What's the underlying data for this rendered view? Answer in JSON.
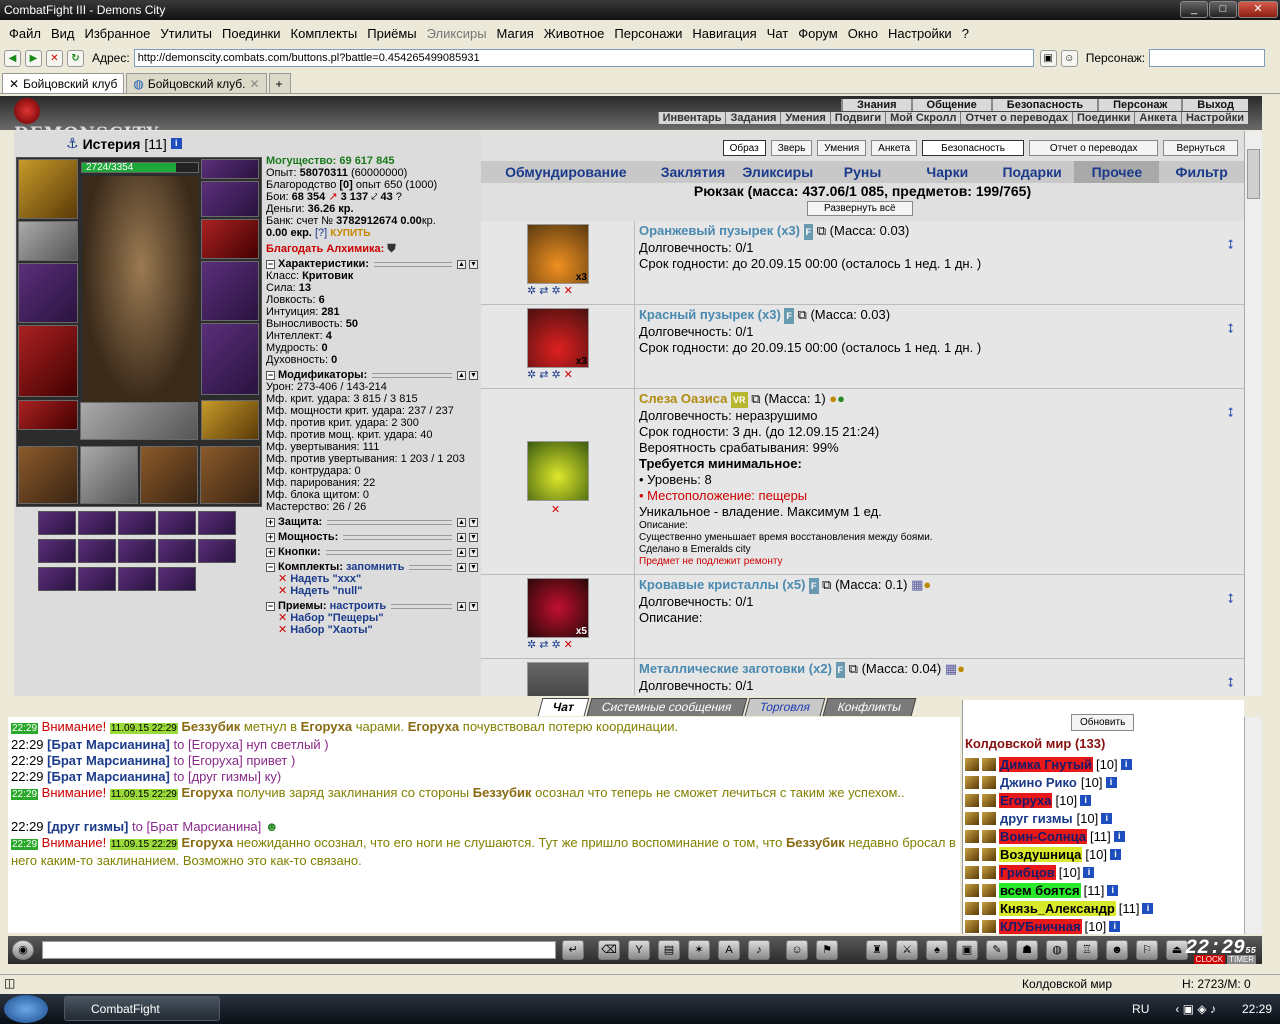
{
  "window": {
    "title": "CombatFight III - Demons City"
  },
  "menu": [
    "Файл",
    "Вид",
    "Избранное",
    "Утилиты",
    "Поединки",
    "Комплекты",
    "Приёмы",
    "Эликсиры",
    "Магия",
    "Животное",
    "Персонажи",
    "Навигация",
    "Чат",
    "Форум",
    "Окно",
    "Настройки",
    "?"
  ],
  "address": {
    "label": "Адрес:",
    "url": "http://demonscity.combats.com/buttons.pl?battle=0.454265499085931",
    "persona_label": "Персонаж:"
  },
  "tabs": [
    {
      "label": "Бойцовский клуб"
    },
    {
      "label": "Бойцовский клуб."
    }
  ],
  "game_nav": {
    "logo": "DEMONSCITY",
    "top": [
      "Знания",
      "Общение",
      "Безопасность",
      "Персонаж",
      "Выход"
    ],
    "bottom": [
      "Инвентарь",
      "Задания",
      "Умения",
      "Подвиги",
      "Мой Скролл",
      "Отчет о переводах",
      "Поединки",
      "Анкета",
      "Настройки"
    ]
  },
  "character": {
    "name": "Истерия",
    "level": "[11]",
    "hp": "2724/3354",
    "hp_fraction": 0.81
  },
  "stats": {
    "might": "Могущество: 69 617 845",
    "exp": "Опыт:",
    "exp_val": "58070311",
    "exp_next": "(60000000)",
    "nobility": "Благородство",
    "nobility_val": "[0]",
    "nobility_rest": "опыт 650 (1000)",
    "fights": "Бои:",
    "fights_val": "68 354",
    "fights_b": "3 137",
    "fights_c": "43",
    "money": "Деньги:",
    "money_val": "36.26 кр.",
    "bank": "Банк: счет №",
    "bank_val": "3782912674 0.00",
    "bank_unit": "кр.",
    "ekr": "0.00 екр.",
    "help": "[?]",
    "buy": "КУПИТЬ",
    "bless": "Благодать Алхимика:"
  },
  "sections": {
    "chars": "Характеристики:",
    "char_list": [
      [
        "Класс:",
        "Критовик"
      ],
      [
        "Сила:",
        "13"
      ],
      [
        "Ловкость:",
        "6"
      ],
      [
        "Интуиция:",
        "281"
      ],
      [
        "Выносливость:",
        "50"
      ],
      [
        "Интеллект:",
        "4"
      ],
      [
        "Мудрость:",
        "0"
      ],
      [
        "Духовность:",
        "0"
      ]
    ],
    "mods": "Модификаторы:",
    "mod_list": [
      "Урон: 273-406 / 143-214",
      "Мф. крит. удара: 3 815 / 3 815",
      "Мф. мощности крит. удара: 237 / 237",
      "Мф. против крит. удара: 2 300",
      "Мф. против мощ. крит. удара: 40",
      "Мф. увертывания: 111",
      "Мф. против увертывания: 1 203 / 1 203",
      "Мф. контрудара: 0",
      "Мф. парирования: 22",
      "Мф. блока щитом: 0",
      "Мастерство: 26 / 26"
    ],
    "protection": "Защита:",
    "powers": "Мощность:",
    "buttons": "Кнопки:",
    "sets": "Комплекты:",
    "remember": "запомнить",
    "set_list": [
      "Надеть \"xxx\"",
      "Надеть \"null\""
    ],
    "skills": "Приемы:",
    "configure": "настроить",
    "skill_list": [
      "Набор \"Пещеры\"",
      "Набор \"Хаоты\""
    ]
  },
  "inv_buttons": [
    "Образ",
    "Зверь",
    "Умения",
    "Анкета",
    "Безопасность",
    "Отчет о переводах",
    "Вернуться"
  ],
  "categories": [
    "Обмундирование",
    "Заклятия",
    "Эликсиры",
    "Руны",
    "Чарки",
    "Подарки",
    "Прочее",
    "Фильтр"
  ],
  "bag": {
    "title": "Рюкзак (масса: 437.06/1 085, предметов: 199/765)",
    "expand": "Развернуть всё"
  },
  "items": [
    {
      "name": "Оранжевый пузырек (x3)",
      "mass": "(Масса: 0.03)",
      "count": "x3",
      "lines": [
        "Долговечность: 0/1",
        "Срок годности: до 20.09.15 00:00 (осталось 1 нед. 1 дн. )"
      ]
    },
    {
      "name": "Красный пузырек (x3)",
      "mass": "(Масса: 0.03)",
      "count": "x3",
      "lines": [
        "Долговечность: 0/1",
        "Срок годности: до 20.09.15 00:00 (осталось 1 нед. 1 дн. )"
      ]
    },
    {
      "name": "Слеза Оазиса",
      "badge": "VR",
      "mass": "(Масса: 1)",
      "lines": [
        "Долговечность: неразрушимо",
        "Срок годности: 3 дн. (до 12.09.15 21:24)",
        "Вероятность срабатывания: 99%"
      ],
      "req": "Требуется минимальное:",
      "req_level": "• Уровень: 8",
      "req_loc": "• Местоположение: пещеры",
      "unique": "Уникальное - владение. Максимум 1 ед.",
      "desc_label": "Описание:",
      "desc": "Существенно уменьшает время восстановления между боями.",
      "made": "Сделано в Emeralds city",
      "norepair": "Предмет не подлежит ремонту"
    },
    {
      "name": "Кровавые кристаллы (x5)",
      "mass": "(Масса: 0.1)",
      "count": "x5",
      "lines": [
        "Долговечность: 0/1",
        "Описание:"
      ]
    },
    {
      "name": "Металлические заготовки (x2)",
      "mass": "(Масса: 0.04)",
      "lines": [
        "Долговечность: 0/1"
      ]
    }
  ],
  "chat_tabs": [
    "Чат",
    "Системные сообщения",
    "Торговля",
    "Конфликты"
  ],
  "chat": {
    "t": "22:29",
    "d": "11.09.15 22:29",
    "att": "Внимание!",
    "m1a": "Беззубик",
    "m1b": "метнул в",
    "m1c": "Егоруха",
    "m1d": "чарами.",
    "m1e": "Егоруха",
    "m1f": "почувствовал потерю координации.",
    "p1": "[Брат Марсианина]",
    "to": "to",
    "p1t": "[Егоруха]",
    "p1m": "нуп светлый )",
    "p2m": "привет )",
    "p3t": "[друг гизмы]",
    "p3m": "ку)",
    "m2a": "Егоруха",
    "m2b": "получив заряд заклинания со стороны",
    "m2c": "Беззубик",
    "m2d": "осознал что теперь не сможет лечиться с таким же успехом..",
    "p4": "[друг гизмы]",
    "p4t": "[Брат Марсианина]",
    "m3a": "Егоруха",
    "m3b": "неожиданно осознал, что его ноги не слушаются. Тут же пришло воспоминание о том, что",
    "m3c": "Беззубик",
    "m3d": "недавно бросал в него каким-то заклинанием. Возможно это как-то связано."
  },
  "users": {
    "refresh": "Обновить",
    "location": "Колдовской мир (133)",
    "list": [
      [
        "Димка Гнутый",
        "[10]",
        "red"
      ],
      [
        "Джино Рико",
        "[10]",
        ""
      ],
      [
        "Егоруха",
        "[10]",
        "red"
      ],
      [
        "друг гизмы",
        "[10]",
        ""
      ],
      [
        "Воин-Солнца",
        "[11]",
        "red"
      ],
      [
        "Воздушница",
        "[10]",
        "yel"
      ],
      [
        "Грибцов",
        "[10]",
        "red"
      ],
      [
        "всем боятся",
        "[11]",
        "grn"
      ],
      [
        "Князь_Александр",
        "[11]",
        "yel"
      ],
      [
        "КЛУБничная",
        "[10]",
        "red"
      ]
    ]
  },
  "clock": {
    "time": "22:29",
    "sec": "55",
    "clock": "CLOCK",
    "timer": "TIMER"
  },
  "statusbar": {
    "location": "Колдовской мир",
    "hm": "H: 2723/M: 0"
  },
  "taskbar": {
    "app": "CombatFight",
    "lang": "RU",
    "time": "22:29"
  }
}
